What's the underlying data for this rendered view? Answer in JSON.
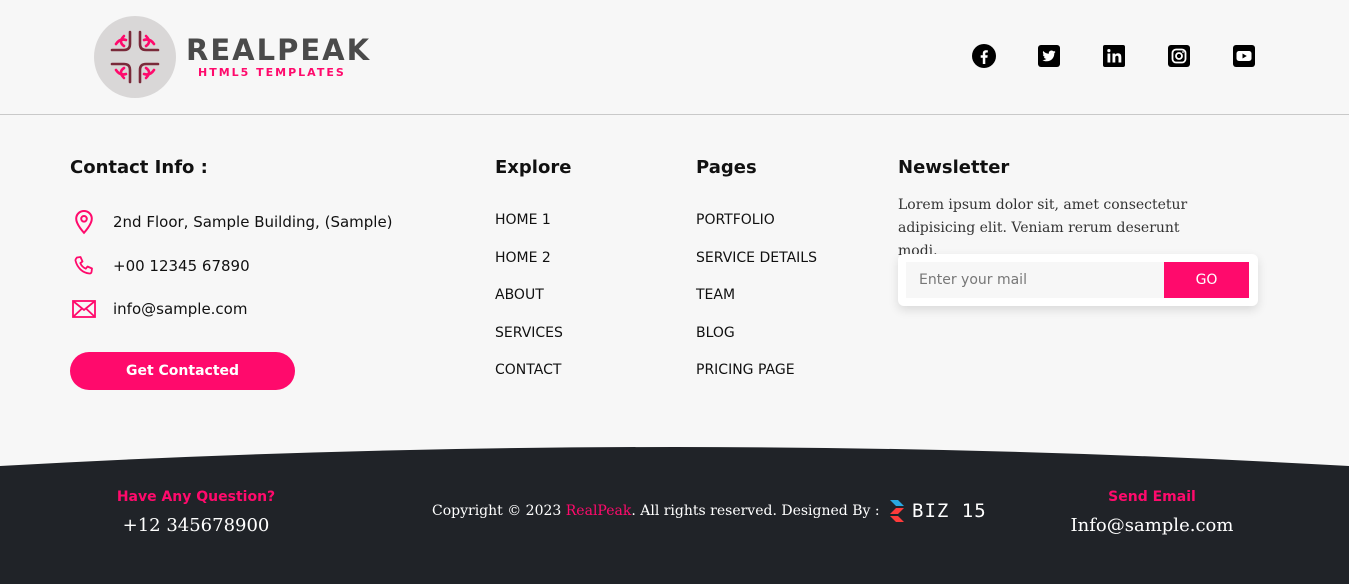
{
  "header": {
    "logo_title": "REALPEAK",
    "logo_subtitle": "HTML5 TEMPLATES",
    "socials": [
      "facebook-icon",
      "twitter-icon",
      "linkedin-icon",
      "instagram-icon",
      "youtube-icon"
    ]
  },
  "contact": {
    "title": "Contact Info :",
    "address": "2nd Floor, Sample Building, (Sample)",
    "phone": "+00 12345 67890",
    "email": "info@sample.com",
    "button": "Get Contacted"
  },
  "explore": {
    "title": "Explore",
    "items": [
      "HOME 1",
      "HOME 2",
      "ABOUT",
      "SERVICES",
      "CONTACT"
    ]
  },
  "pages": {
    "title": "Pages",
    "items": [
      "PORTFOLIO",
      "SERVICE DETAILS",
      "TEAM",
      "BLOG",
      "PRICING PAGE"
    ]
  },
  "newsletter": {
    "title": "Newsletter",
    "text": "Lorem ipsum dolor sit, amet consectetur adipisicing elit. Veniam rerum deserunt modi.",
    "placeholder": "Enter your mail",
    "button": "GO"
  },
  "footer": {
    "question_label": "Have Any Question?",
    "question_value": "+12 345678900",
    "copyright_prefix": "Copyright © 2023 ",
    "brand": "RealPeak",
    "copyright_suffix": ". All rights reserved. Designed By : ",
    "designer": "BIZ 15",
    "email_label": "Send Email",
    "email_value": "Info@sample.com"
  },
  "colors": {
    "accent": "#ff0a6c",
    "dark": "#202328",
    "background": "#f7f7f7"
  }
}
